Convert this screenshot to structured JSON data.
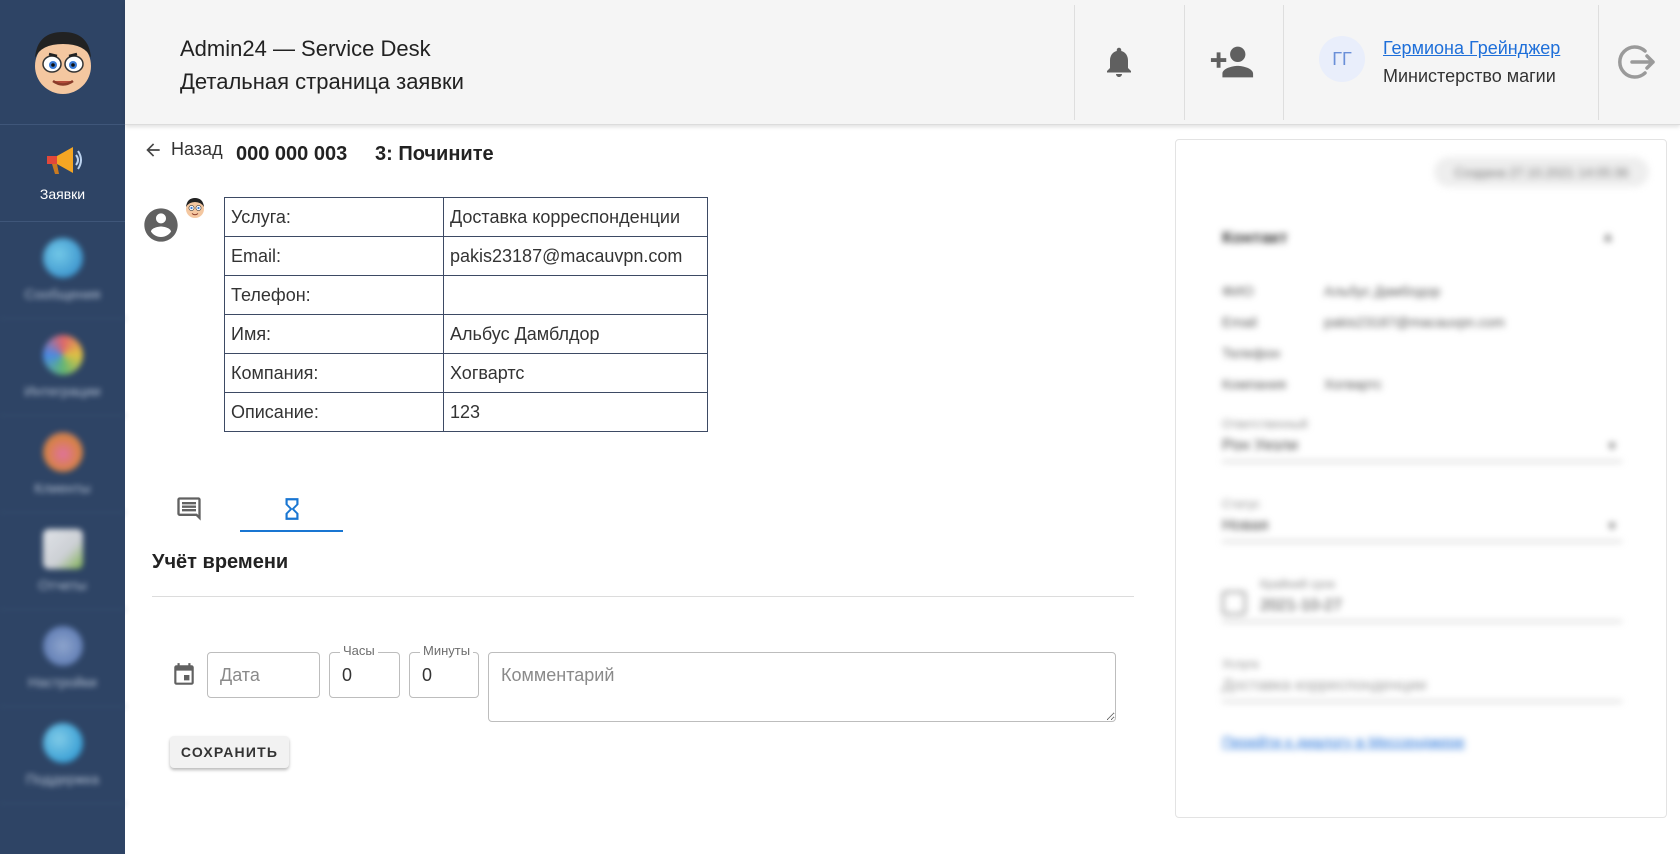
{
  "header": {
    "app_title": "Admin24 — Service Desk",
    "page_subtitle": "Детальная страница заявки",
    "user": {
      "initials": "ГГ",
      "name": "Гермиона Грейнджер",
      "organization": "Министерство магии"
    }
  },
  "sidebar": {
    "items": [
      {
        "label": "Заявки",
        "icon": "megaphone-icon",
        "active": true
      },
      {
        "label": "Сообщения",
        "icon": "messages-icon"
      },
      {
        "label": "Интеграции",
        "icon": "integrations-icon"
      },
      {
        "label": "Клиенты",
        "icon": "clients-icon"
      },
      {
        "label": "Отчеты",
        "icon": "reports-icon"
      },
      {
        "label": "Настройки",
        "icon": "settings-icon"
      },
      {
        "label": "Поддержка",
        "icon": "support-icon"
      }
    ]
  },
  "ticket": {
    "back_label": "Назад",
    "number": "000 000 003",
    "title": "3: Почините"
  },
  "info_table": [
    {
      "key": "Услуга:",
      "value": "Доставка корреспонденции"
    },
    {
      "key": "Email:",
      "value": "pakis23187@macauvpn.com"
    },
    {
      "key": "Телефон:",
      "value": ""
    },
    {
      "key": "Имя:",
      "value": "Альбус Дамблдор"
    },
    {
      "key": "Компания:",
      "value": "Хогвартс"
    },
    {
      "key": "Описание:",
      "value": "123"
    }
  ],
  "tabs": [
    {
      "icon": "comment-icon",
      "active": false
    },
    {
      "icon": "hourglass-icon",
      "active": true
    }
  ],
  "time_tracking": {
    "title": "Учёт времени",
    "date_placeholder": "Дата",
    "hours_label": "Часы",
    "hours_value": "0",
    "minutes_label": "Минуты",
    "minutes_value": "0",
    "comment_placeholder": "Комментарий",
    "save_label": "СОХРАНИТЬ"
  },
  "right_panel": {
    "pill": "Создана 27.10.2021 14:05:36",
    "section": "Контакт",
    "rows": [
      {
        "k": "ФИО",
        "v": "Альбус Дамблдор"
      },
      {
        "k": "Email",
        "v": "pakis23187@macauvpn.com"
      },
      {
        "k": "Телефон",
        "v": ""
      },
      {
        "k": "Компания",
        "v": "Хогвартс"
      }
    ],
    "assignee_label": "Ответственный",
    "assignee_value": "Рон Уизли",
    "status_label": "Статус",
    "status_value": "Новая",
    "deadline_label": "Крайний срок",
    "deadline_value": "2021-10-27",
    "service_label": "Услуга",
    "service_value": "Доставка корреспонденции",
    "link": "Перейти к диалогу в Мессенджере"
  },
  "colors": {
    "sidebar": "#2e4465",
    "accent": "#1976d2",
    "link": "#1e6fd9",
    "header_bg": "#f5f5f5"
  }
}
